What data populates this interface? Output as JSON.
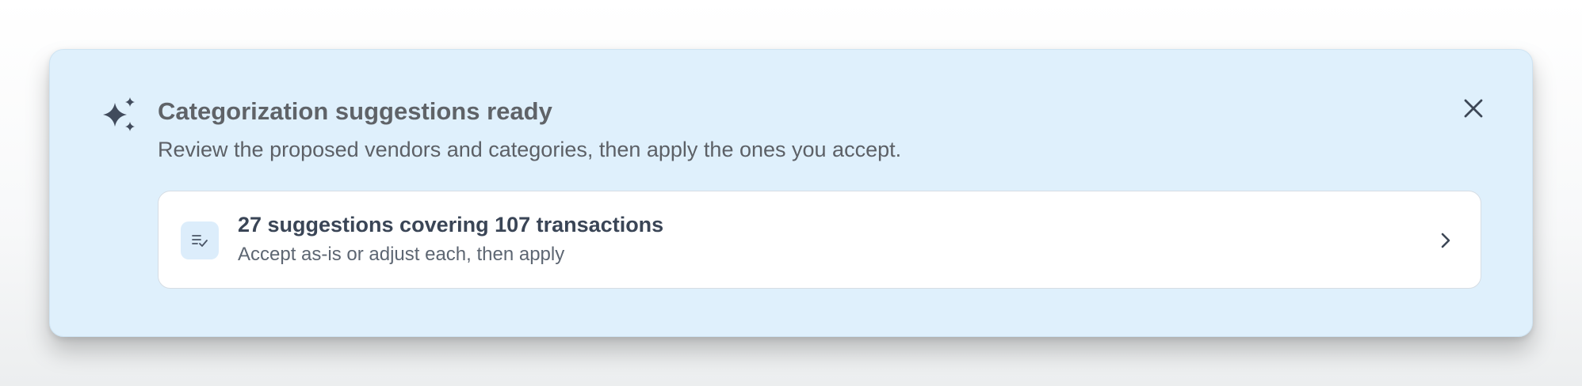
{
  "banner": {
    "icon": "sparkles-icon",
    "title": "Categorization suggestions ready",
    "subtitle": "Review the proposed vendors and categories, then apply the ones you accept.",
    "close_icon": "close-icon",
    "colors": {
      "background": "#dff0fc",
      "icon": "#414b5c"
    }
  },
  "suggestion_card": {
    "icon": "list-check-icon",
    "title": "27 suggestions covering 107 transactions",
    "subtitle": "Accept as-is or adjust each, then apply",
    "chevron_icon": "chevron-right-icon"
  }
}
